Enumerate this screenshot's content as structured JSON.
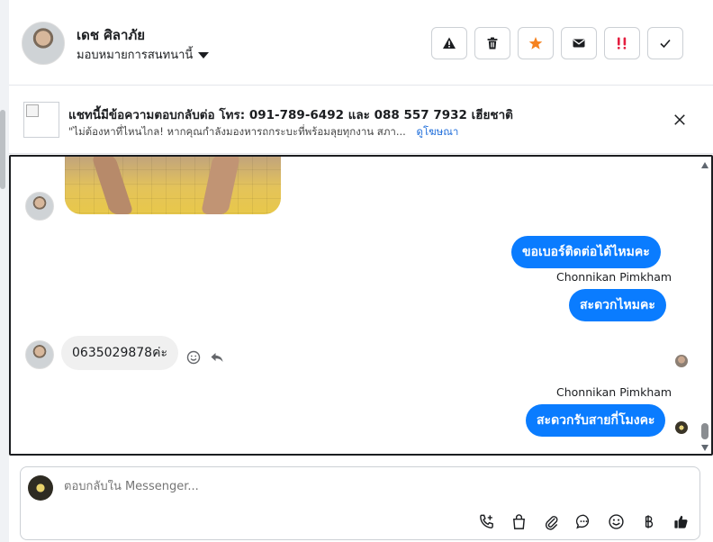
{
  "header": {
    "name": "เดช ศิลาภัย",
    "assign_label": "มอบหมายการสนทนานี้",
    "actions": [
      {
        "name": "report-button",
        "icon": "warning-icon"
      },
      {
        "name": "delete-button",
        "icon": "trash-icon"
      },
      {
        "name": "star-button",
        "icon": "star-icon"
      },
      {
        "name": "unread-button",
        "icon": "envelope-icon"
      },
      {
        "name": "spam-button",
        "icon": "exclamation-icon"
      },
      {
        "name": "done-button",
        "icon": "check-icon"
      }
    ]
  },
  "ad": {
    "title": "แชทนี้มีข้อความตอบกลับต่อ โทร: 091-789-6492 และ 088 557 7932 เฮียชาติ",
    "snippet": "\"ไม่ต้องหาที่ไหนไกล! หากคุณกำลังมองหารถกระบะที่พร้อมลุยทุกงาน สภา...",
    "link": "ดูโฆษณา"
  },
  "messages": {
    "m1_text": "ขอเบอร์ติดต่อได้ไหมคะ",
    "sender_1": "Chonnikan Pimkham",
    "m2_text": "สะดวกไหมคะ",
    "m3_text": "0635029878ค่ะ",
    "sender_2": "Chonnikan Pimkham",
    "m4_text": "สะดวกรับสายกี่โมงคะ"
  },
  "composer": {
    "placeholder": "ตอบกลับใน Messenger..."
  },
  "colors": {
    "accent": "#0a7cff",
    "star": "#f5821f",
    "spam": "#e41e3f"
  }
}
